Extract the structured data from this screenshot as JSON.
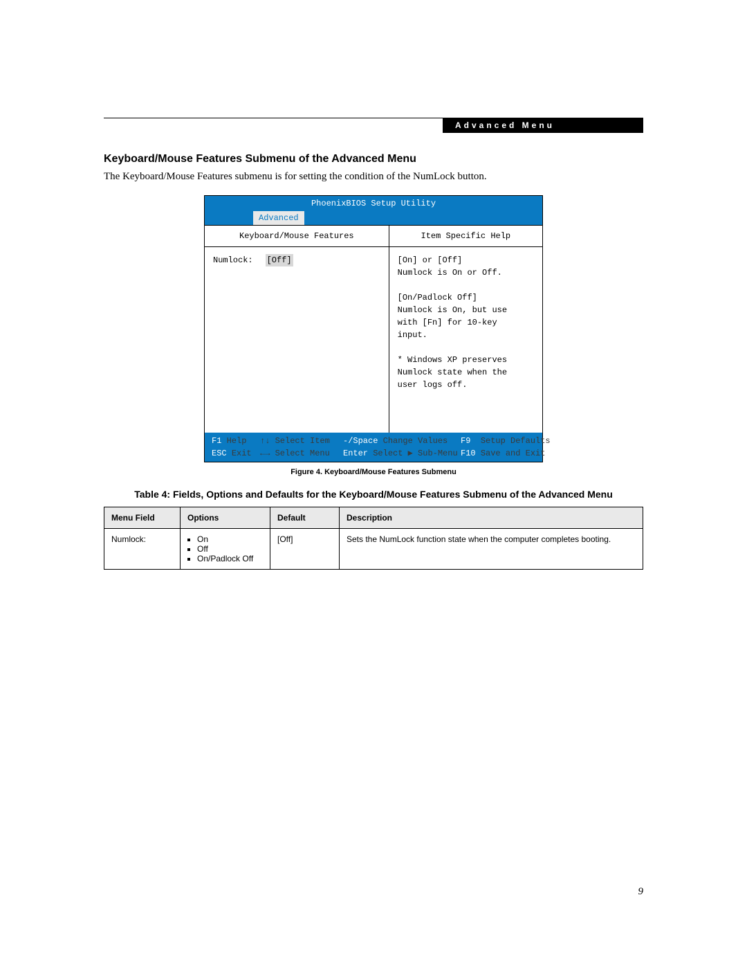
{
  "header": {
    "label": "Advanced Menu"
  },
  "section": {
    "title": "Keyboard/Mouse Features Submenu of the Advanced Menu",
    "intro": "The Keyboard/Mouse Features submenu is for setting the condition of the NumLock button."
  },
  "bios": {
    "title": "PhoenixBIOS Setup Utility",
    "tab": "Advanced",
    "left_header": "Keyboard/Mouse Features",
    "right_header": "Item Specific Help",
    "field_label": "Numlock:",
    "field_value": "[Off]",
    "help_text": "[On] or [Off]\nNumlock is On or Off.\n\n[On/Padlock Off]\nNumlock is On, but use\nwith [Fn] for 10-key\ninput.\n\n* Windows XP preserves\nNumlock state when the\nuser logs off.",
    "footer": {
      "f1": "F1",
      "help": "Help",
      "select_item_arrows": "↑↓",
      "select_item": "Select Item",
      "change_key": "-/Space",
      "change_values": "Change Values",
      "f9": "F9",
      "setup_defaults": "Setup Defaults",
      "esc": "ESC",
      "exit": "Exit",
      "select_menu_arrows": "←→",
      "select_menu": "Select Menu",
      "enter": "Enter",
      "select_submenu": "Select ▶ Sub-Menu",
      "f10": "F10",
      "save_exit": "Save and Exit"
    }
  },
  "figure_caption": "Figure 4.  Keyboard/Mouse Features Submenu",
  "table_caption": "Table 4: Fields, Options and Defaults for the Keyboard/Mouse Features Submenu of the Advanced Menu",
  "table": {
    "headers": {
      "c1": "Menu Field",
      "c2": "Options",
      "c3": "Default",
      "c4": "Description"
    },
    "row1": {
      "field": "Numlock:",
      "opt1": "On",
      "opt2": "Off",
      "opt3": "On/Padlock Off",
      "default": "[Off]",
      "desc": "Sets the NumLock function state when the computer completes booting."
    }
  },
  "page_number": "9"
}
